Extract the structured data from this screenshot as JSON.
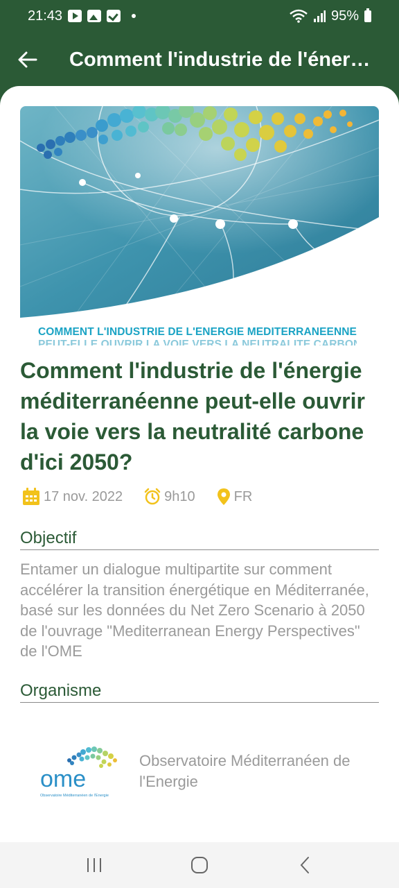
{
  "status_bar": {
    "time": "21:43",
    "battery": "95%",
    "icons": [
      "youtube-icon",
      "gallery-icon",
      "check-icon",
      "wifi-icon",
      "signal-icon",
      "battery-icon"
    ]
  },
  "app_bar": {
    "back_icon": "arrow-left-icon",
    "title": "Comment l'industrie de l'énergi…"
  },
  "hero": {
    "caption_line1": "COMMENT L'INDUSTRIE DE L'ENERGIE MEDITERRANEENNE",
    "caption_line2": "PEUT-ELLE OUVRIR LA VOIE VERS LA NEUTRALITE CARBONE"
  },
  "event": {
    "title": "Comment l'industrie de l'énergie méditerranéenne peut-elle ouvrir la voie vers la neutralité carbone d'ici 2050?",
    "date": "17 nov. 2022",
    "time": "9h10",
    "language": "FR"
  },
  "objectif": {
    "heading": "Objectif",
    "text": "Entamer un dialogue multipartite sur comment accélérer la transition énergétique en Méditerranée, basé sur les données du Net Zero Scenario à 2050 de l'ouvrage \"Mediterranean Energy Perspectives\" de l'OME"
  },
  "organisme": {
    "heading": "Organisme",
    "logo_text": "ome",
    "logo_subtext": "Observatoire Méditerranéen de l'Energie",
    "name": "Observatoire Méditerranéen de l'Energie"
  },
  "colors": {
    "primary": "#2b5a36",
    "accent_yellow": "#f2c21b",
    "muted_text": "#9a9a9a",
    "caption_blue": "#1aa3c4"
  }
}
